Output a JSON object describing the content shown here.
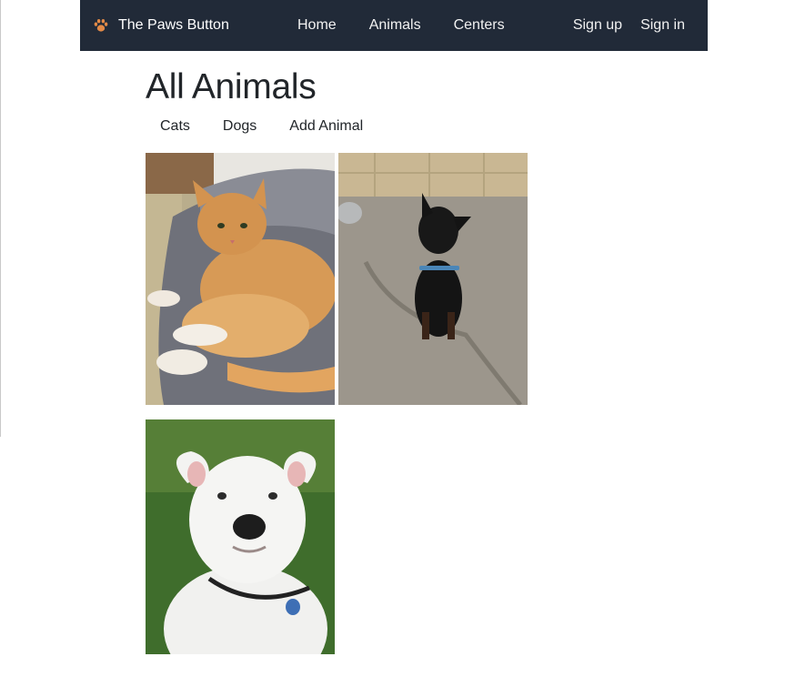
{
  "navbar": {
    "brand": "The Paws Button",
    "brand_icon": "paw-icon",
    "links": [
      {
        "label": "Home"
      },
      {
        "label": "Animals"
      },
      {
        "label": "Centers"
      }
    ],
    "auth": [
      {
        "label": "Sign up"
      },
      {
        "label": "Sign in"
      }
    ]
  },
  "page": {
    "title": "All Animals",
    "subnav": [
      {
        "label": "Cats"
      },
      {
        "label": "Dogs"
      },
      {
        "label": "Add Animal"
      }
    ]
  },
  "animals": [
    {
      "kind": "orange-tabby-kitten"
    },
    {
      "kind": "black-dog"
    },
    {
      "kind": "white-pitbull-dog"
    }
  ],
  "colors": {
    "navbar_bg": "#212a38",
    "paw_accent": "#e38a47",
    "text": "#212529"
  }
}
